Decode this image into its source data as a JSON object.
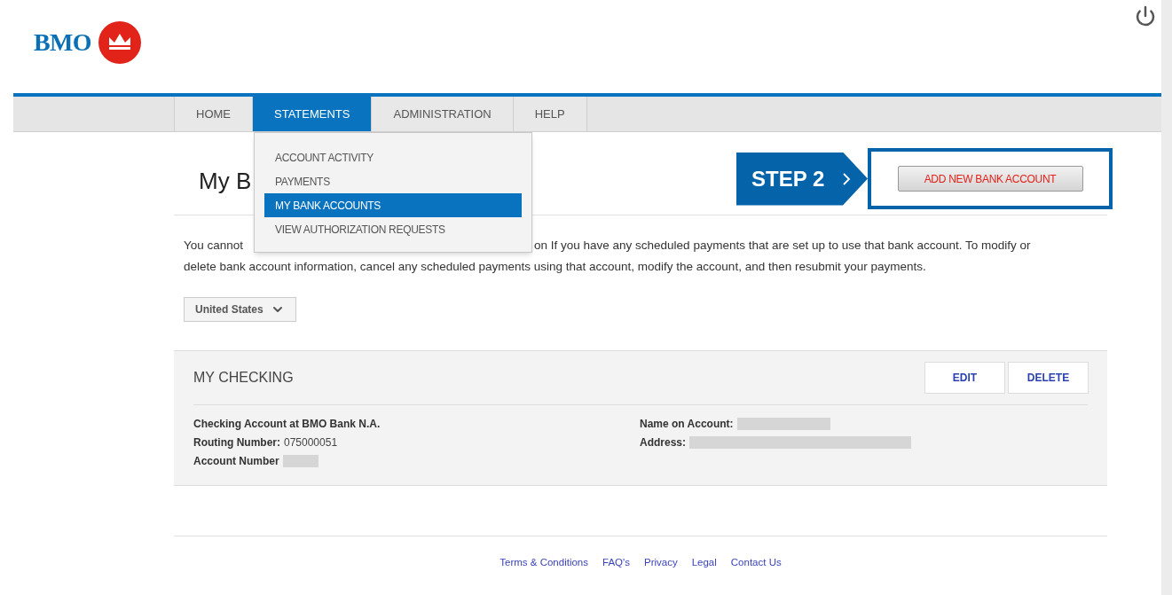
{
  "logo": {
    "text": "BMO"
  },
  "nav": {
    "tabs": [
      {
        "label": "HOME",
        "selected": false
      },
      {
        "label": "STATEMENTS",
        "selected": true
      },
      {
        "label": "ADMINISTRATION",
        "selected": false
      },
      {
        "label": "HELP",
        "selected": false
      }
    ]
  },
  "menu": {
    "items": [
      {
        "label": "ACCOUNT ACTIVITY",
        "selected": false
      },
      {
        "label": "PAYMENTS",
        "selected": false
      },
      {
        "label": "MY BANK ACCOUNTS",
        "selected": true
      },
      {
        "label": "VIEW AUTHORIZATION REQUESTS",
        "selected": false
      }
    ]
  },
  "page_title": "My B",
  "step_callout": "STEP 2",
  "add_button": "ADD NEW BANK ACCOUNT",
  "notice": {
    "line_1_start": "You cannot",
    "line_1_end": "on If you have any scheduled payments that are set up to use that bank account. To modify or",
    "line_2": "delete bank account information, cancel any scheduled payments using that account, modify the account, and then resubmit your payments."
  },
  "country_select": {
    "value": "United States"
  },
  "account": {
    "title": "MY CHECKING",
    "actions": [
      "EDIT",
      "DELETE"
    ],
    "bank": "Checking Account at BMO Bank N.A.",
    "left_fields": [
      {
        "label": "Routing Number:",
        "value": "075000051",
        "redacted": false
      },
      {
        "label": "Account Number",
        "redacted": true
      }
    ],
    "right_fields": [
      {
        "label": "Name on Account:",
        "redacted": true
      },
      {
        "label": "Address:",
        "redacted": true
      }
    ]
  },
  "footer": {
    "links": [
      "Terms & Conditions",
      "FAQ's",
      "Privacy",
      "Legal",
      "Contact Us"
    ]
  }
}
